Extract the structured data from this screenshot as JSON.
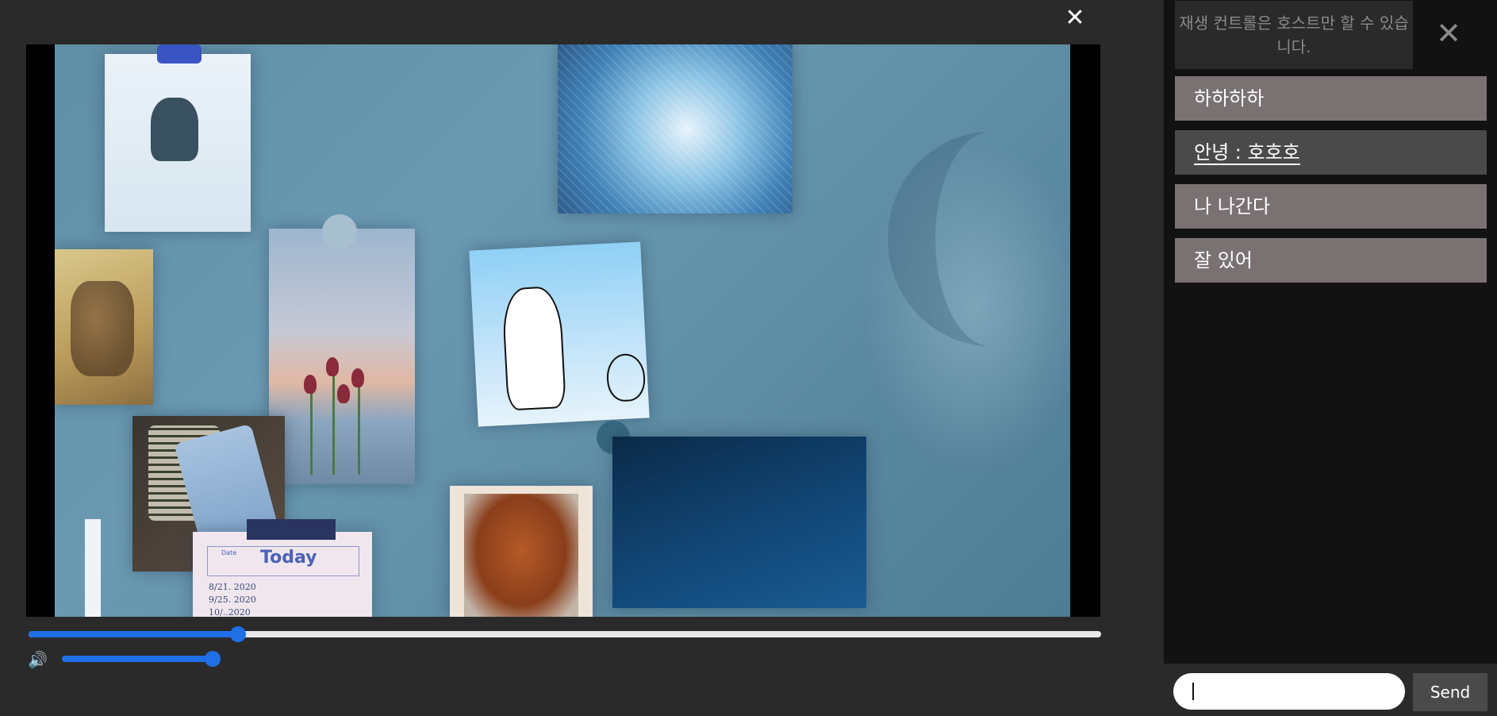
{
  "player": {
    "close_icon": "close-icon",
    "progress": 0.195,
    "volume": 1.0,
    "speaker_icon": "speaker-icon"
  },
  "video_card_note": {
    "today": "Today",
    "date_label": "Date",
    "handwriting": [
      "8/21. 2020",
      "9/25. 2020",
      "10/..2020"
    ]
  },
  "sidebar": {
    "notice": "재생 컨트롤은 호스트만 할 수 있습니다.",
    "close_icon": "close-icon",
    "messages": [
      {
        "text": "하하하하",
        "selected": false
      },
      {
        "text": "안녕 : 호호호",
        "selected": true
      },
      {
        "text": "나 나간다",
        "selected": false
      },
      {
        "text": "잘 있어",
        "selected": false
      }
    ],
    "input_value": "",
    "send_label": "Send"
  },
  "colors": {
    "accent": "#1f6fe6",
    "message_bg": "#7a7272",
    "message_selected_bg": "#4a4a4a",
    "sidebar_bg": "#121212",
    "player_bg": "#2a2a2a"
  }
}
